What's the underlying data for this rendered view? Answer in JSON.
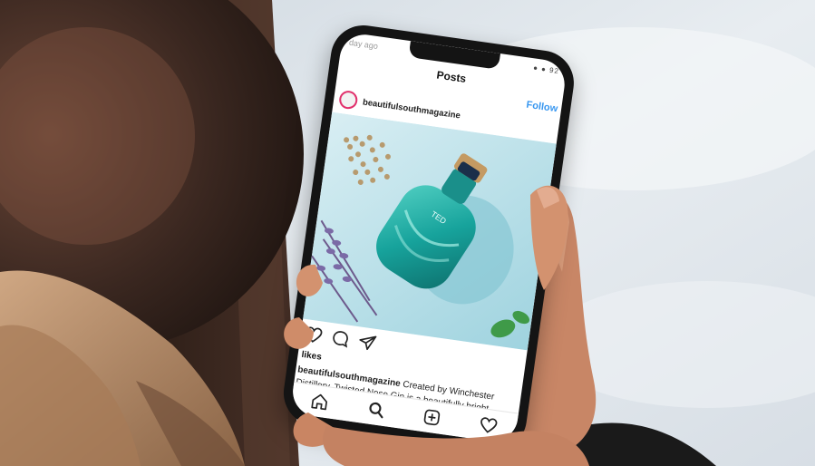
{
  "scene": {
    "description_colors": {
      "background": "#dfe6ec",
      "head_hair": "#3b2a22",
      "skin": "#d89978",
      "phone": "#141414",
      "gin_bottle": "#1aa6a0"
    }
  },
  "screen": {
    "status_time": "day ago",
    "status_icons": "● ● 92",
    "nav_title": "Posts",
    "follow_label": "Follow",
    "post": {
      "username": "beautifulsouthmagazine",
      "bottle_label": "TED"
    },
    "likes": "likes",
    "caption_username": "beautifulsouthmagazine",
    "caption_line1_text": " Created by Winchester",
    "caption_line2_text": "Distillery, Twisted Nose Gin is a beautifully bright"
  },
  "icons": {
    "heart": "heart-icon",
    "comment": "comment-icon",
    "share": "send-icon",
    "home": "home-icon",
    "search": "search-icon",
    "create": "add-post-icon",
    "activity": "heart-icon"
  }
}
